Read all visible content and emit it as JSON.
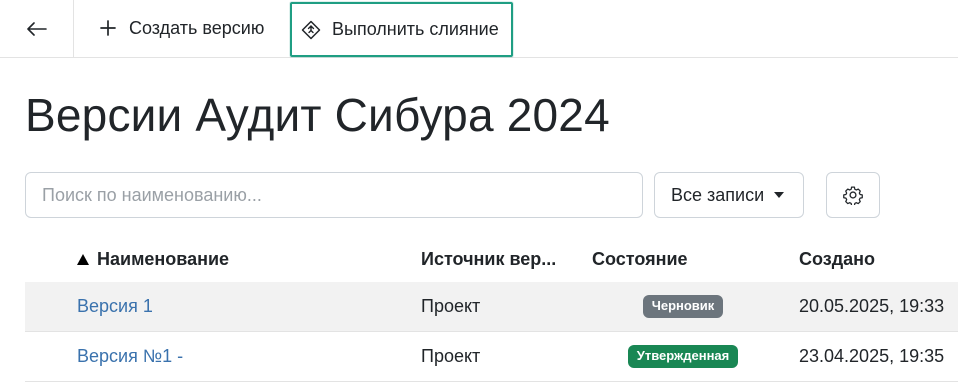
{
  "toolbar": {
    "back_icon": "arrow-left-icon",
    "create_label": "Создать версию",
    "create_icon": "plus-icon",
    "merge_label": "Выполнить слияние",
    "merge_icon": "merge-diamond-icon",
    "merge_highlight_color": "#1f9e83"
  },
  "page": {
    "title": "Версии Аудит Сибура 2024"
  },
  "search": {
    "placeholder": "Поиск по наименованию...",
    "value": ""
  },
  "filter": {
    "selected": "Все записи"
  },
  "settings": {
    "icon": "gear-icon"
  },
  "table": {
    "sort_indicator": "▲",
    "columns": [
      "Наименование",
      "Источник вер...",
      "Состояние",
      "Создано"
    ],
    "rows": [
      {
        "name": "Версия 1",
        "source": "Проект",
        "status": "Черновик",
        "status_color": "#6c757d",
        "created": "20.05.2025, 19:33"
      },
      {
        "name": "Версия №1 -",
        "source": "Проект",
        "status": "Утвержденная",
        "status_color": "#198754",
        "created": "23.04.2025, 19:35"
      }
    ]
  }
}
